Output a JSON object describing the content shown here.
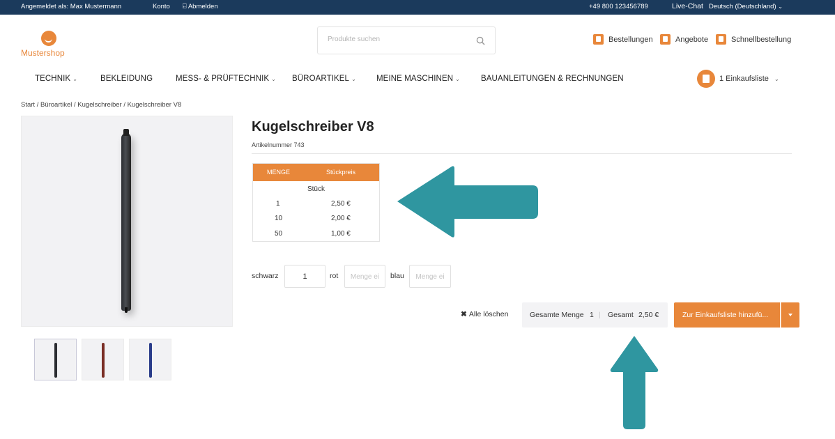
{
  "topbar": {
    "logged_in_as": "Angemeldet als: Max Mustermann",
    "account": "Konto",
    "logout": "Abmelden",
    "phone": "+49 800 123456789",
    "live_chat": "Live-Chat",
    "language": "Deutsch (Deutschland)"
  },
  "header": {
    "logo_text": "Mustershop",
    "search_placeholder": "Produkte suchen",
    "links": {
      "orders": "Bestellungen",
      "offers": "Angebote",
      "quick_order": "Schnellbestellung"
    }
  },
  "nav": {
    "items": [
      "TECHNIK",
      "BEKLEIDUNG",
      "MESS- & PRÜFTECHNIK",
      "BÜROARTIKEL",
      "MEINE MASCHINEN",
      "BAUANLEITUNGEN & RECHNUNGEN"
    ],
    "shopping_list": "1 Einkaufsliste"
  },
  "breadcrumb": "Start / Büroartikel / Kugelschreiber / Kugelschreiber V8",
  "product": {
    "title": "Kugelschreiber V8",
    "article_number": "Artikelnummer 743",
    "thumbnail_colors": [
      "#2b2d31",
      "#7a2e25",
      "#2a3c8a"
    ]
  },
  "price_table": {
    "header_qty": "MENGE",
    "header_price": "Stückpreis",
    "unit": "Stück",
    "rows": [
      {
        "qty": "1",
        "price": "2,50 €"
      },
      {
        "qty": "10",
        "price": "2,00 €"
      },
      {
        "qty": "50",
        "price": "1,00 €"
      }
    ]
  },
  "variants": {
    "black_label": "schwarz",
    "black_value": "1",
    "red_label": "rot",
    "blue_label": "blau",
    "qty_placeholder": "Menge ei"
  },
  "actions": {
    "clear_all": "Alle löschen",
    "total_qty_label": "Gesamte Menge",
    "total_qty_value": "1",
    "total_label": "Gesamt",
    "total_value": "2,50 €",
    "add_button": "Zur Einkaufsliste hinzufü..."
  },
  "colors": {
    "accent": "#e8873a",
    "topbar": "#1b3a5c",
    "arrow": "#2f96a0"
  }
}
